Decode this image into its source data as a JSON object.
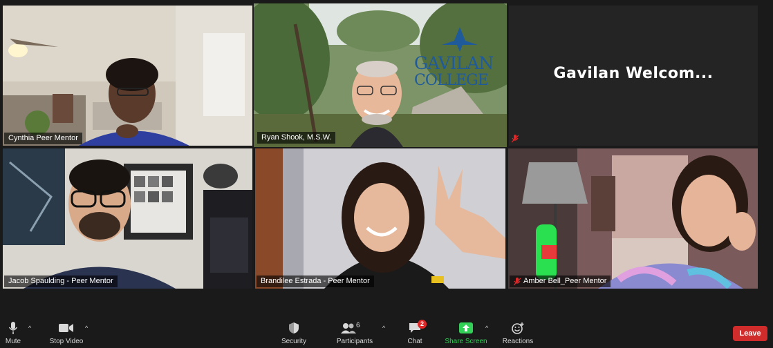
{
  "participants": [
    {
      "name": "Cynthia Peer Mentor",
      "muted": false
    },
    {
      "name": "Ryan Shook, M.S.W.",
      "muted": false,
      "active_speaker": true
    },
    {
      "name": "",
      "muted": true,
      "shared_text": "Gavilan  Welcom..."
    },
    {
      "name": "Jacob Spaulding - Peer Mentor",
      "muted": false
    },
    {
      "name": "Brandilee Estrada - Peer Mentor",
      "muted": false
    },
    {
      "name": "Amber Bell_Peer Mentor",
      "muted": true
    }
  ],
  "background_logo": {
    "line1": "GAVILAN",
    "line2": "COLLEGE"
  },
  "toolbar": {
    "mute": "Mute",
    "stop_video": "Stop Video",
    "security": "Security",
    "participants": "Participants",
    "participants_count": "6",
    "chat": "Chat",
    "chat_badge": "2",
    "share_screen": "Share Screen",
    "reactions": "Reactions",
    "leave": "Leave"
  },
  "colors": {
    "active_speaker_border": "#e8e580",
    "share_green": "#33d058",
    "leave_red": "#d02c2c",
    "muted_red": "#e02828"
  }
}
